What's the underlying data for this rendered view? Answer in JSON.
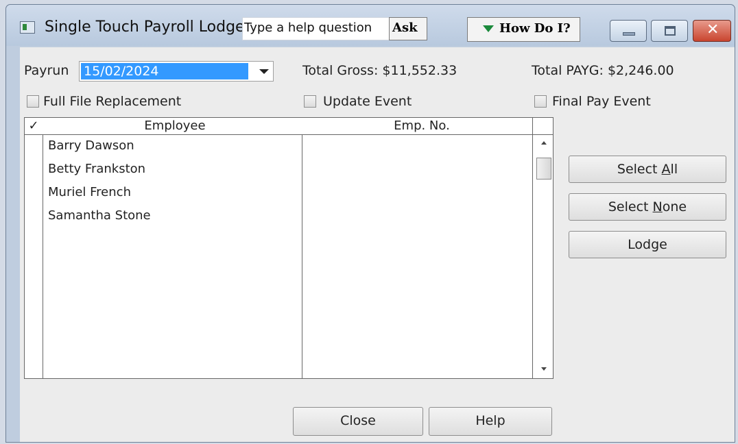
{
  "window": {
    "title": "Single Touch Payroll Lodge",
    "help_placeholder": "Type a help question",
    "ask_label": "Ask",
    "howdoi_label": "How Do I?",
    "controls": [
      "minimize",
      "maximize",
      "close"
    ],
    "close_glyph": "✕"
  },
  "form": {
    "payrun_label": "Payrun",
    "payrun_value": "15/02/2024",
    "total_gross": "Total Gross: $11,552.33",
    "total_payg": "Total PAYG: $2,246.00",
    "checkboxes": {
      "full_file_replacement": "Full File Replacement",
      "update_event": "Update Event",
      "final_pay_event": "Final Pay Event"
    }
  },
  "table": {
    "check_header": "✓",
    "columns": [
      "Employee",
      "Emp. No."
    ],
    "rows": [
      {
        "employee": "Barry Dawson",
        "emp_no": ""
      },
      {
        "employee": "Betty Frankston",
        "emp_no": ""
      },
      {
        "employee": "Muriel French",
        "emp_no": ""
      },
      {
        "employee": "Samantha Stone",
        "emp_no": ""
      }
    ]
  },
  "buttons": {
    "select_all": {
      "pre": "Select ",
      "accel": "A",
      "post": "ll"
    },
    "select_none": {
      "pre": "Select ",
      "accel": "N",
      "post": "one"
    },
    "lodge": "Lodge",
    "close": "Close",
    "help": "Help"
  },
  "icons": {
    "app": "app-window-icon",
    "howdoi": "triangle-down-icon",
    "dropdown": "chevron-down-icon",
    "scroll_up": "arrow-up-icon",
    "scroll_down": "arrow-down-icon"
  },
  "colors": {
    "selection": "#3399ff",
    "close_button": "#c9452f",
    "howdoi_triangle": "#1b8a3c"
  }
}
